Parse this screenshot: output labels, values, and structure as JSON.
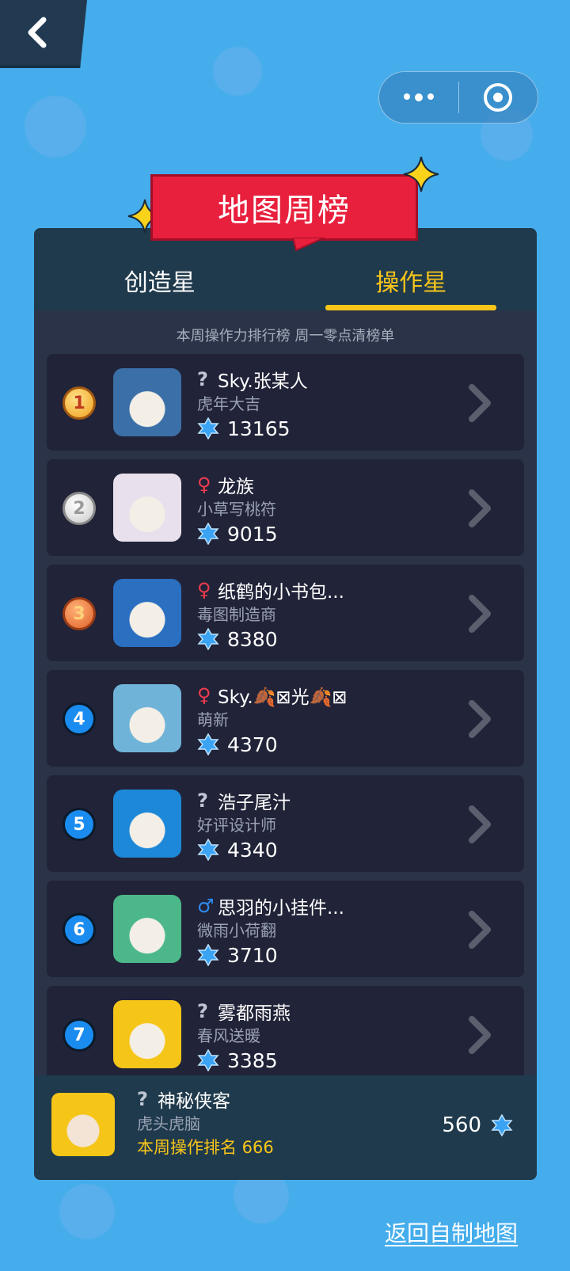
{
  "header": {
    "banner_title": "地图周榜"
  },
  "tabs": [
    {
      "label": "创造星",
      "active": false
    },
    {
      "label": "操作星",
      "active": true
    }
  ],
  "subtitle": "本周操作力排行榜 周一零点清榜单",
  "leaderboard": [
    {
      "rank": "1",
      "gender": "unknown",
      "name": "Sky.张某人",
      "title": "虎年大吉",
      "score": "13165",
      "avatar_color": "#3b6fa8"
    },
    {
      "rank": "2",
      "gender": "female",
      "name": "龙族",
      "title": "小草写桃符",
      "score": "9015",
      "avatar_color": "#e8e0ec"
    },
    {
      "rank": "3",
      "gender": "female",
      "name": "纸鹤的小书包...",
      "title": "毒图制造商",
      "score": "8380",
      "avatar_color": "#2a6fc0"
    },
    {
      "rank": "4",
      "gender": "female",
      "name": "Sky.🍂⊠光🍂⊠",
      "title": "萌新",
      "score": "4370",
      "avatar_color": "#6fb3d8"
    },
    {
      "rank": "5",
      "gender": "unknown",
      "name": "浩子尾汁",
      "title": "好评设计师",
      "score": "4340",
      "avatar_color": "#1d88d8"
    },
    {
      "rank": "6",
      "gender": "male",
      "name": "思羽的小挂件...",
      "title": "微雨小荷翻",
      "score": "3710",
      "avatar_color": "#4cb88a"
    },
    {
      "rank": "7",
      "gender": "unknown",
      "name": "雾都雨燕",
      "title": "春风送暖",
      "score": "3385",
      "avatar_color": "#f5c518"
    }
  ],
  "my_rank": {
    "gender": "unknown",
    "name": "神秘侠客",
    "title": "虎头虎脑",
    "rank_label": "本周操作排名 666",
    "score": "560",
    "avatar_color": "#f5c518"
  },
  "return_link": "返回自制地图",
  "colors": {
    "accent": "#f9c51a",
    "banner": "#e8203d",
    "panel": "#2a3347",
    "row": "#212338"
  }
}
